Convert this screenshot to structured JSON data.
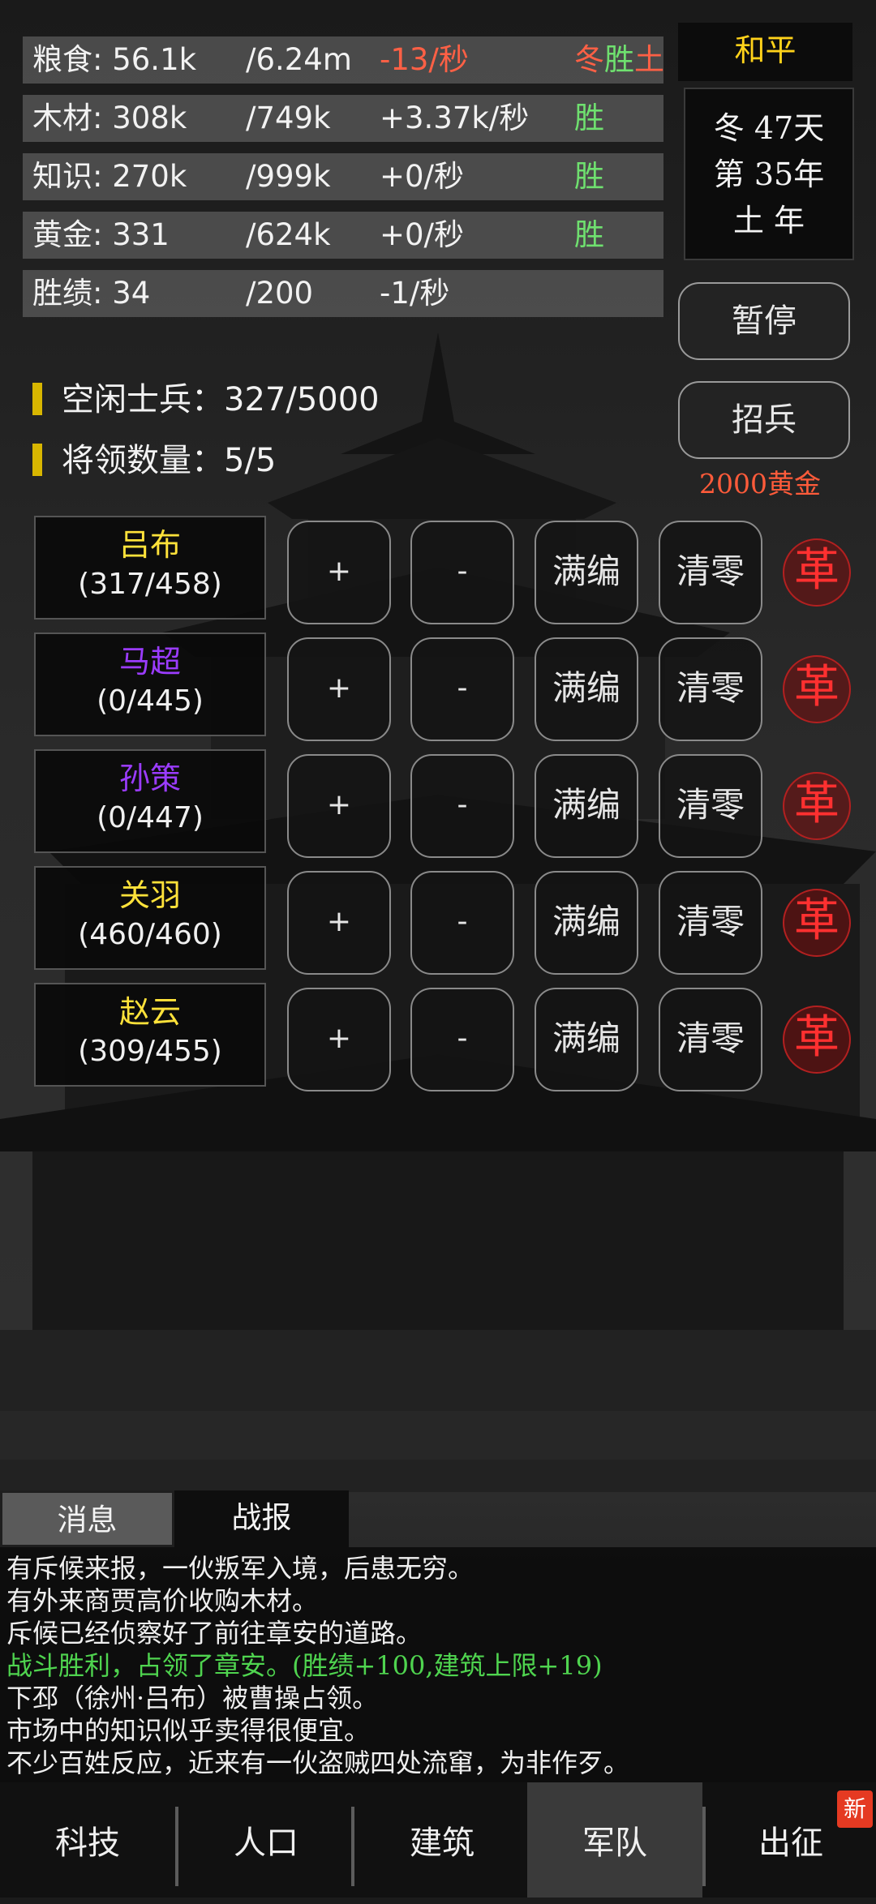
{
  "resources": [
    {
      "name": "粮食: 56.1k",
      "max": "/6.24m",
      "rate": "-13/秒",
      "status": "冬胜土",
      "rate_color": "#ff6045",
      "status_color": "#ff6045",
      "status_highlight": "#6fe06f"
    },
    {
      "name": "木材: 308k",
      "max": "/749k",
      "rate": "+3.37k/秒",
      "status": "胜",
      "rate_color": "#f2f2f2",
      "status_color": "#6fe06f"
    },
    {
      "name": "知识: 270k",
      "max": "/999k",
      "rate": "+0/秒",
      "status": "胜",
      "rate_color": "#f2f2f2",
      "status_color": "#6fe06f"
    },
    {
      "name": "黄金: 331",
      "max": "/624k",
      "rate": "+0/秒",
      "status": "胜",
      "rate_color": "#f2f2f2",
      "status_color": "#6fe06f"
    },
    {
      "name": "胜绩: 34",
      "max": "/200",
      "rate": "-1/秒",
      "status": "",
      "rate_color": "#f2f2f2",
      "status_color": "#6fe06f"
    }
  ],
  "state": "和平",
  "date": {
    "line1": "冬 47天",
    "line2": "第 35年",
    "line3": "土 年"
  },
  "buttons": {
    "pause": "暂停",
    "recruit": "招兵",
    "recruit_cost": "2000黄金"
  },
  "stats": {
    "idle_soldiers": "空闲士兵：327/5000",
    "generals_count": "将领数量：5/5"
  },
  "general_actions": {
    "add": "+",
    "remove": "-",
    "fill": "满编",
    "clear": "清零",
    "dismiss": "革"
  },
  "generals": [
    {
      "name": "吕布",
      "count": "(317/458)",
      "color": "#ffe23a"
    },
    {
      "name": "马超",
      "count": "(0/445)",
      "color": "#9b3cff"
    },
    {
      "name": "孙策",
      "count": "(0/447)",
      "color": "#9b3cff"
    },
    {
      "name": "关羽",
      "count": "(460/460)",
      "color": "#ffe23a"
    },
    {
      "name": "赵云",
      "count": "(309/455)",
      "color": "#ffe23a"
    }
  ],
  "tabs": {
    "messages": "消息",
    "reports": "战报"
  },
  "messages": [
    {
      "text": "有斥候来报，一伙叛军入境，后患无穷。",
      "color": "normal"
    },
    {
      "text": "有外来商贾高价收购木材。",
      "color": "normal"
    },
    {
      "text": "斥候已经侦察好了前往章安的道路。",
      "color": "normal"
    },
    {
      "text": "战斗胜利，占领了章安。(胜绩+100,建筑上限+19)",
      "color": "green"
    },
    {
      "text": "下邳（徐州·吕布）被曹操占领。",
      "color": "normal"
    },
    {
      "text": "市场中的知识似乎卖得很便宜。",
      "color": "normal"
    },
    {
      "text": "不少百姓反应，近来有一伙盗贼四处流窜，为非作歹。",
      "color": "normal"
    }
  ],
  "nav": [
    "科技",
    "人口",
    "建筑",
    "军队",
    "出征"
  ],
  "nav_active": "军队",
  "new_badge": "新"
}
